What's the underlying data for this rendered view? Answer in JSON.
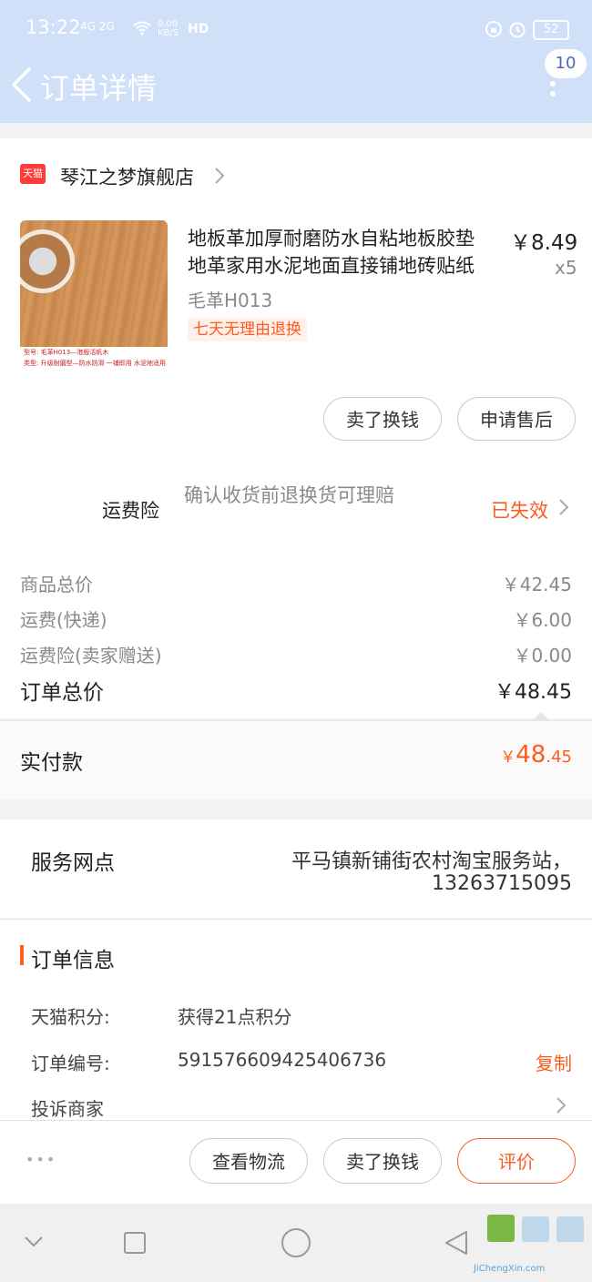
{
  "status_bar": {
    "time": "13:22",
    "net": "4G 2G",
    "speed": "0.00 KB/S",
    "hd": "HD",
    "battery": "52"
  },
  "header": {
    "back_label": "<",
    "title": "订单详情",
    "badge_count": "10"
  },
  "shop": {
    "logo_text": "天猫",
    "name": "琴江之梦旗舰店"
  },
  "product": {
    "title_line1": "地板革加厚耐磨防水自粘地板胶垫",
    "title_line2": "地革家用水泥地面直接铺地砖贴纸",
    "price": "￥8.49",
    "quantity": "x5",
    "sku": "毛革H013",
    "tag": "七天无理由退换",
    "image_caption1": "型号: 毛革H013—港版活帆木",
    "image_caption2": "类型: 升级耐磨型—防水防滑 一铺即用 水泥地适用"
  },
  "product_actions": {
    "sell_label": "卖了换钱",
    "after_sale_label": "申请售后"
  },
  "shipping_insurance": {
    "label": "运费险",
    "desc": "确认收货前退换货可理赔",
    "status": "已失效"
  },
  "price_summary": {
    "rows": [
      {
        "label": "商品总价",
        "value": "￥42.45"
      },
      {
        "label": "运费(快递)",
        "value": "￥6.00"
      },
      {
        "label": "运费险(卖家赠送)",
        "value": "￥0.00"
      }
    ],
    "total_label": "订单总价",
    "total_value": "￥48.45",
    "paid_label": "实付款",
    "paid_symbol": "￥",
    "paid_int": "48",
    "paid_dec": ".45"
  },
  "service_point": {
    "label": "服务网点",
    "value_line1": "平马镇新铺街农村淘宝服务站，",
    "value_line2": "13263715095"
  },
  "order_info": {
    "title": "订单信息",
    "points_label": "天猫积分:",
    "points_value": "获得21点积分",
    "order_no_label": "订单编号:",
    "order_no_value": "591576609425406736",
    "copy_label": "复制",
    "complain_label": "投诉商家"
  },
  "bottom_actions": {
    "more_label": "•••",
    "logistics_label": "查看物流",
    "sell_label": "卖了换钱",
    "review_label": "评价"
  },
  "watermark": {
    "text": "JiChengXin.com"
  },
  "colors": {
    "accent": "#ff5b1f",
    "header_bg": "#cfe0f8"
  }
}
